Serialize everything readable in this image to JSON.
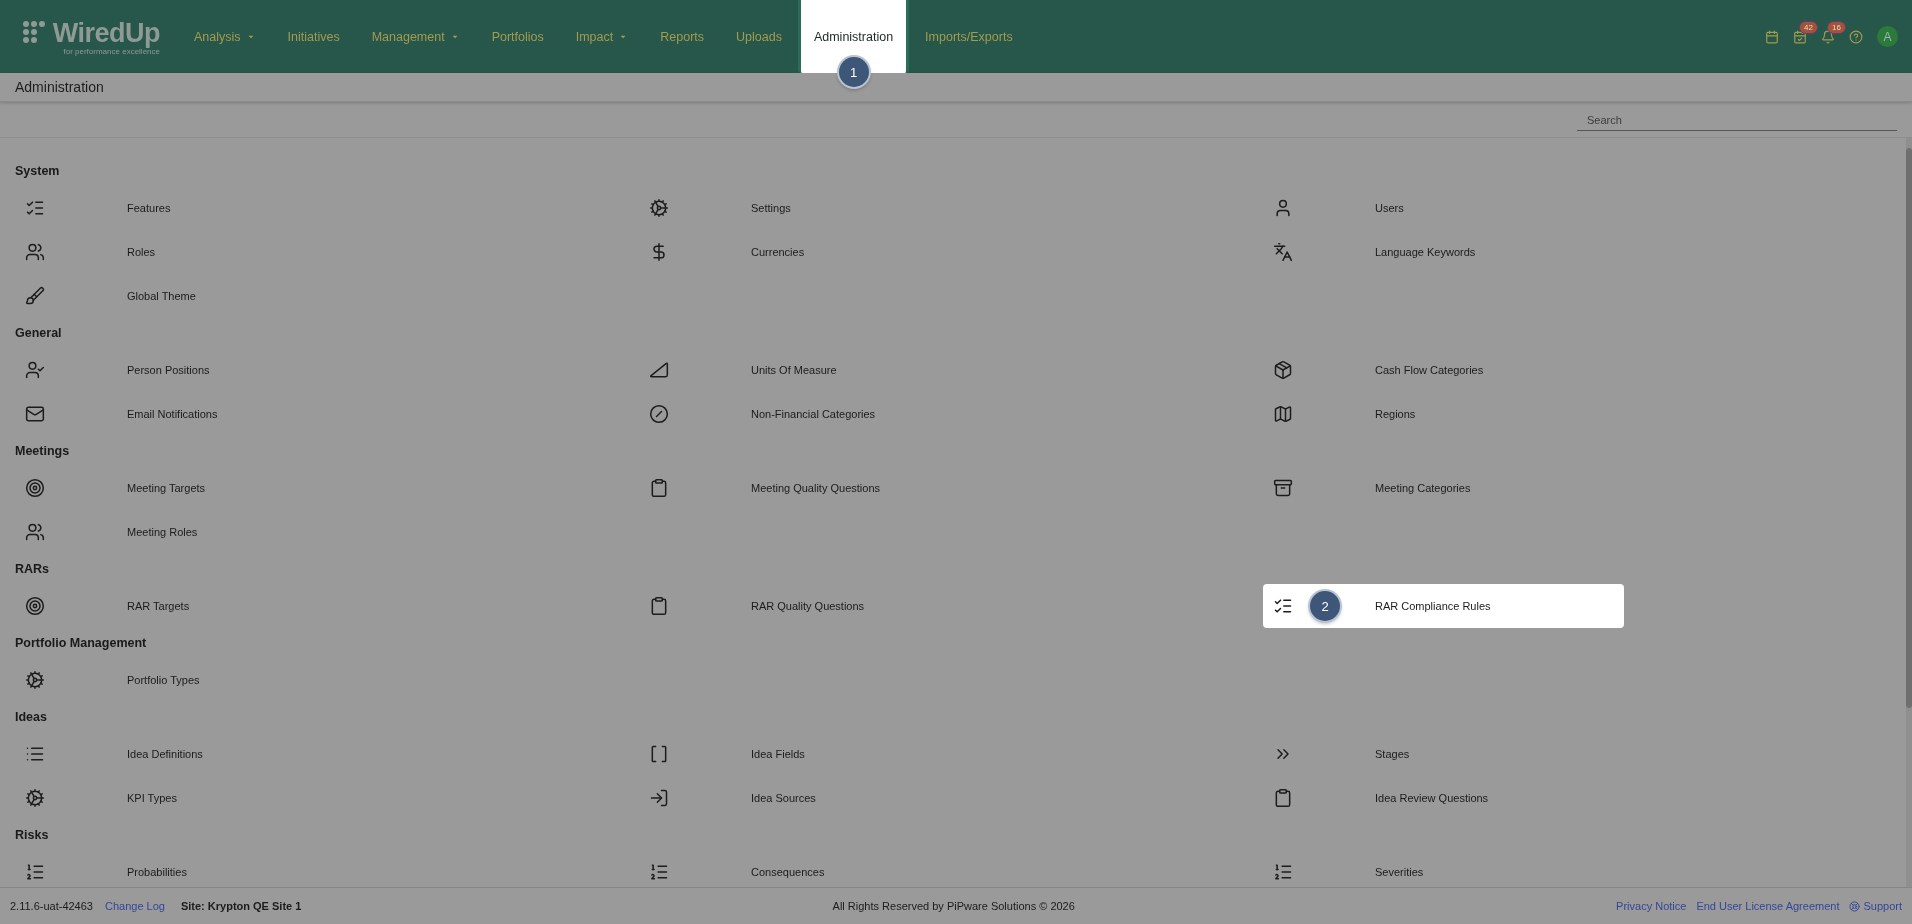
{
  "header": {
    "logo": {
      "name": "WiredUp",
      "tagline": "for performance excellence"
    },
    "nav": [
      {
        "label": "Analysis",
        "has_menu": true,
        "selected": false
      },
      {
        "label": "Initiatives",
        "has_menu": false,
        "selected": false
      },
      {
        "label": "Management",
        "has_menu": true,
        "selected": false
      },
      {
        "label": "Portfolios",
        "has_menu": false,
        "selected": false
      },
      {
        "label": "Impact",
        "has_menu": true,
        "selected": false
      },
      {
        "label": "Reports",
        "has_menu": false,
        "selected": false
      },
      {
        "label": "Uploads",
        "has_menu": false,
        "selected": false
      },
      {
        "label": "Administration",
        "has_menu": false,
        "selected": true,
        "step": "1"
      },
      {
        "label": "Imports/Exports",
        "has_menu": false,
        "selected": false
      }
    ],
    "tools": [
      {
        "kind": "calendar"
      },
      {
        "kind": "tasks",
        "badge": "42"
      },
      {
        "kind": "bell",
        "badge": "16"
      },
      {
        "kind": "help"
      }
    ],
    "avatar": "A"
  },
  "page_title": "Administration",
  "search": {
    "placeholder": "Search"
  },
  "sections": [
    {
      "title": "System",
      "items": [
        {
          "label": "Features",
          "highlighted": false
        },
        {
          "label": "Settings",
          "highlighted": false
        },
        {
          "label": "Users",
          "highlighted": false
        },
        {
          "label": "Roles",
          "highlighted": false
        },
        {
          "label": "Currencies",
          "highlighted": false
        },
        {
          "label": "Language Keywords",
          "highlighted": false
        },
        {
          "label": "Global Theme",
          "highlighted": false
        }
      ]
    },
    {
      "title": "General",
      "items": [
        {
          "label": "Person Positions",
          "highlighted": false
        },
        {
          "label": "Units Of Measure",
          "highlighted": false
        },
        {
          "label": "Cash Flow Categories",
          "highlighted": false
        },
        {
          "label": "Email Notifications",
          "highlighted": false
        },
        {
          "label": "Non-Financial Categories",
          "highlighted": false
        },
        {
          "label": "Regions",
          "highlighted": false
        }
      ]
    },
    {
      "title": "Meetings",
      "items": [
        {
          "label": "Meeting Targets",
          "highlighted": false
        },
        {
          "label": "Meeting Quality Questions",
          "highlighted": false
        },
        {
          "label": "Meeting Categories",
          "highlighted": false
        },
        {
          "label": "Meeting Roles",
          "highlighted": false
        }
      ]
    },
    {
      "title": "RARs",
      "items": [
        {
          "label": "RAR Targets",
          "highlighted": false
        },
        {
          "label": "RAR Quality Questions",
          "highlighted": false
        },
        {
          "label": "RAR Compliance Rules",
          "highlighted": true,
          "step": "2"
        }
      ]
    },
    {
      "title": "Portfolio Management",
      "items": [
        {
          "label": "Portfolio Types",
          "highlighted": false
        }
      ]
    },
    {
      "title": "Ideas",
      "items": [
        {
          "label": "Idea Definitions",
          "highlighted": false
        },
        {
          "label": "Idea Fields",
          "highlighted": false
        },
        {
          "label": "Stages",
          "highlighted": false
        },
        {
          "label": "KPI Types",
          "highlighted": false
        },
        {
          "label": "Idea Sources",
          "highlighted": false
        },
        {
          "label": "Idea Review Questions",
          "highlighted": false
        }
      ]
    },
    {
      "title": "Risks",
      "items": [
        {
          "label": "Probabilities",
          "highlighted": false
        },
        {
          "label": "Consequences",
          "highlighted": false
        },
        {
          "label": "Severities",
          "highlighted": false
        }
      ]
    }
  ],
  "footer": {
    "version": "2.11.6-uat-42463",
    "change_log": "Change Log",
    "site": "Site: Krypton QE Site 1",
    "copyright": "All Rights Reserved by PiPware Solutions © 2026",
    "links": [
      "Privacy Notice",
      "End User License Agreement"
    ],
    "support": "Support"
  }
}
